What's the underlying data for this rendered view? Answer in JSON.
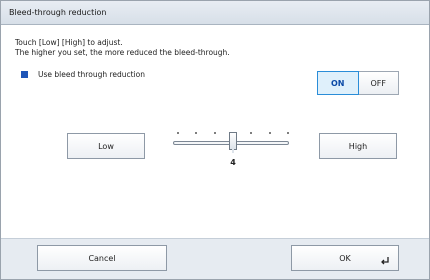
{
  "dialog": {
    "title": "Bleed-through reduction"
  },
  "description": {
    "line1": "Touch [Low] [High] to adjust.",
    "line2": "The higher you set, the more reduced the bleed-through."
  },
  "option": {
    "checkbox_label": "Use bleed through reduction",
    "checked": true
  },
  "toggle": {
    "on_label": "ON",
    "off_label": "OFF",
    "selected": "ON"
  },
  "adjust": {
    "low_label": "Low",
    "high_label": "High",
    "value": "4",
    "min": 1,
    "max": 7,
    "current": 4
  },
  "footer": {
    "cancel_label": "Cancel",
    "ok_label": "OK"
  },
  "colors": {
    "accent": "#1f56b8",
    "on_highlight": "#2a8dd8"
  }
}
